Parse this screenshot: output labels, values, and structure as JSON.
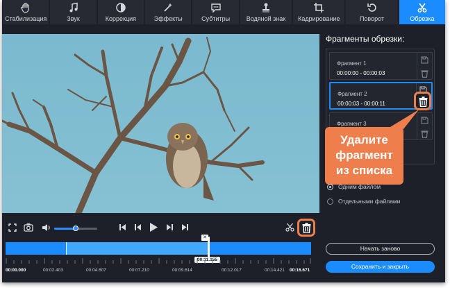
{
  "toolbar": {
    "tabs": [
      {
        "label": "Стабилизация",
        "icon": "hand-stabilize-icon"
      },
      {
        "label": "Звук",
        "icon": "music-note-icon"
      },
      {
        "label": "Коррекция",
        "icon": "contrast-icon"
      },
      {
        "label": "Эффекты",
        "icon": "magic-wand-icon"
      },
      {
        "label": "Субтитры",
        "icon": "speech-bubble-icon"
      },
      {
        "label": "Водяной знак",
        "icon": "stamp-icon"
      },
      {
        "label": "Кадрирование",
        "icon": "crop-icon"
      },
      {
        "label": "Поворот",
        "icon": "rotate-icon"
      },
      {
        "label": "Обрезка",
        "icon": "scissors-icon",
        "active": true
      }
    ]
  },
  "panel": {
    "title": "Фрагменты обрезки:",
    "fragments": [
      {
        "name": "Фрагмент 1",
        "range": "00:00:00 - 00:00:03"
      },
      {
        "name": "Фрагмент 2",
        "range": "00:00:03 - 00:00:11",
        "selected": true
      },
      {
        "name": "Фрагмент 3",
        "range": ""
      }
    ],
    "save_options": [
      "Одним файлом",
      "Отдельными файлами"
    ],
    "selected_option": "Одним файлом",
    "restart_label": "Начать заново",
    "save_label": "Сохранить и закрыть"
  },
  "callout": {
    "lines": [
      "Удалите",
      "фрагмент",
      "из списка"
    ],
    "color": "#ee7f4d"
  },
  "player": {
    "volume_fraction": 0.5,
    "current_time": "00:11.155",
    "ruler_labels": [
      "00:00.000",
      "00:02.403",
      "00:04.807",
      "00:07.210",
      "00:09.614",
      "00:12.017",
      "00:14.421",
      "00:16.671"
    ]
  },
  "colors": {
    "accent": "#1a8cff",
    "background": "#1d2028",
    "callout": "#ee7f4d"
  }
}
